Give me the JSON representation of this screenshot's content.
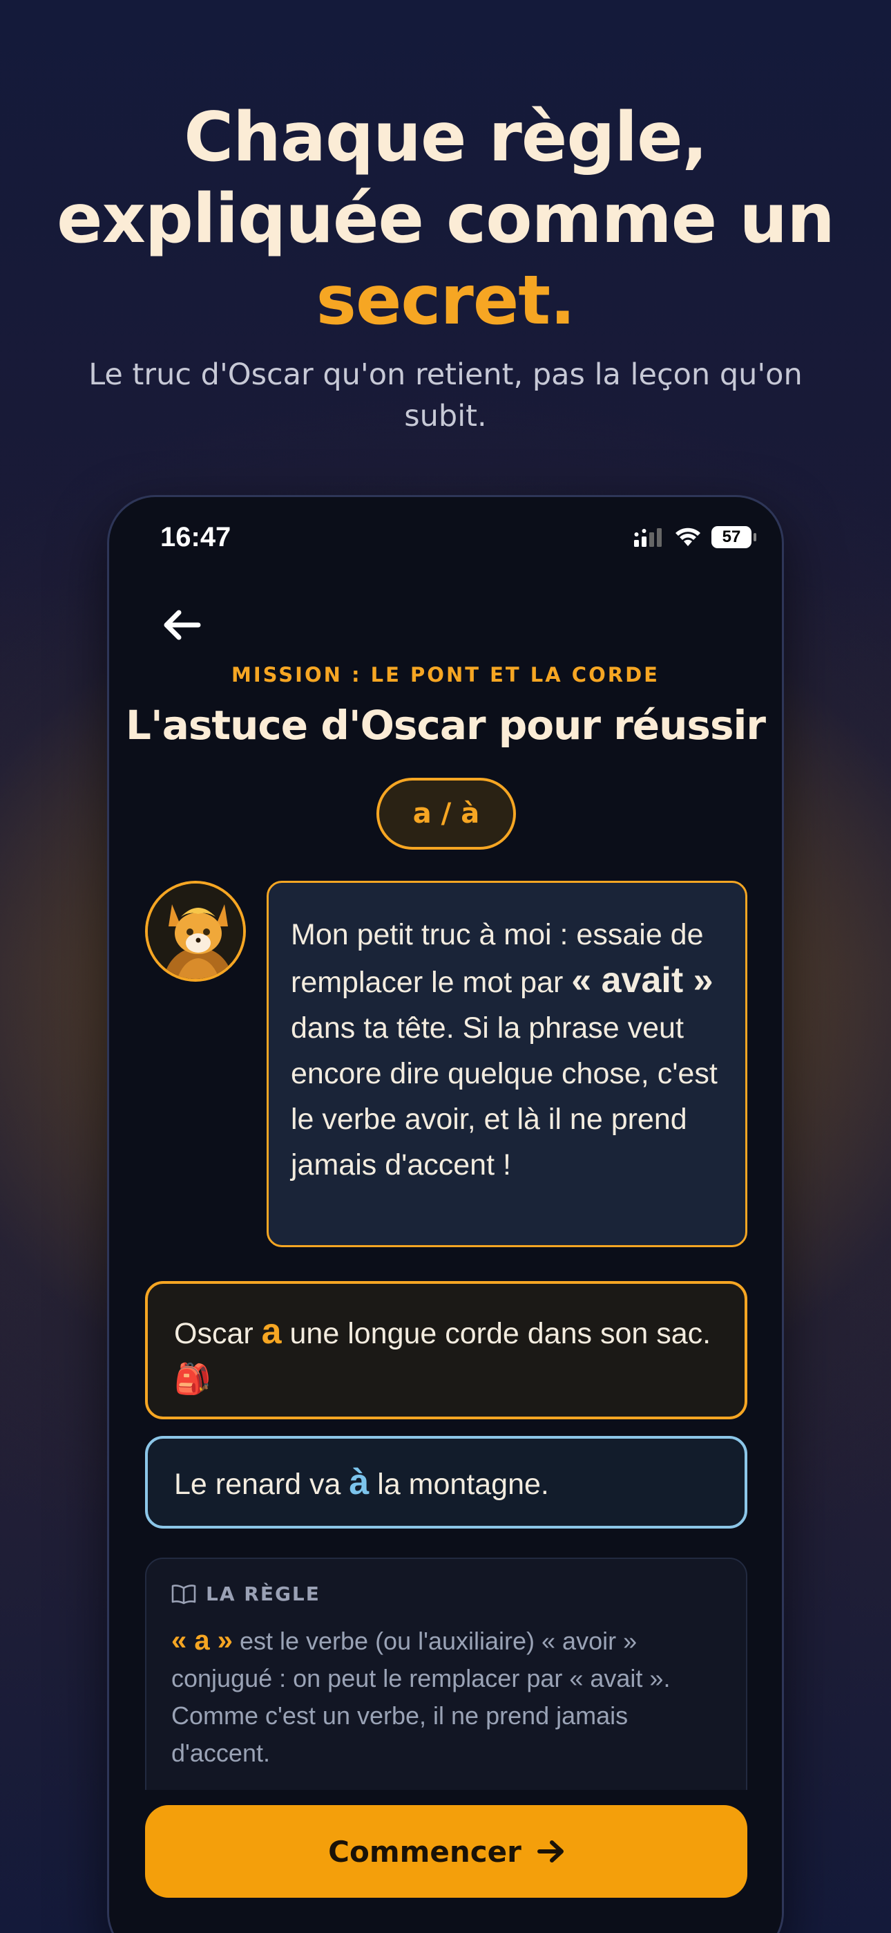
{
  "hero": {
    "title_line1": "Chaque règle,",
    "title_line2": "expliquée comme un",
    "title_accent": "secret.",
    "subtitle": "Le truc d'Oscar qu'on retient, pas la leçon qu'on subit."
  },
  "status_bar": {
    "time": "16:47",
    "battery": "57"
  },
  "screen": {
    "mission_label": "MISSION : LE PONT ET LA CORDE",
    "title": "L'astuce d'Oscar pour réussir",
    "pill": "a / à"
  },
  "bubble": {
    "part1": "Mon petit truc à moi : essaie de remplacer le mot par ",
    "emphasis": "« avait »",
    "part2": " dans ta tête. Si la phrase veut encore dire quelque chose, c'est le verbe avoir, et là il ne prend jamais d'accent !"
  },
  "examples": [
    {
      "before": "Oscar ",
      "highlight": "a",
      "after": " une longue corde dans son sac. 🎒"
    },
    {
      "before": "Le renard va ",
      "highlight": "à",
      "after": " la montagne."
    }
  ],
  "rule": {
    "label": "LA RÈGLE",
    "term": "« a »",
    "text": " est le verbe (ou l'auxiliaire) « avoir » conjugué : on peut le remplacer par « avait ». Comme c'est un verbe, il ne prend jamais d'accent."
  },
  "cta": {
    "label": "Commencer"
  },
  "colors": {
    "accent": "#f6a623",
    "accent_blue": "#8cc6e8",
    "cream": "#fbecd6",
    "screen_bg": "#0b0e19"
  },
  "icons": [
    "back-arrow-icon",
    "signal-icon",
    "wifi-icon",
    "battery-icon",
    "book-icon",
    "arrow-right-icon",
    "fox-avatar"
  ]
}
